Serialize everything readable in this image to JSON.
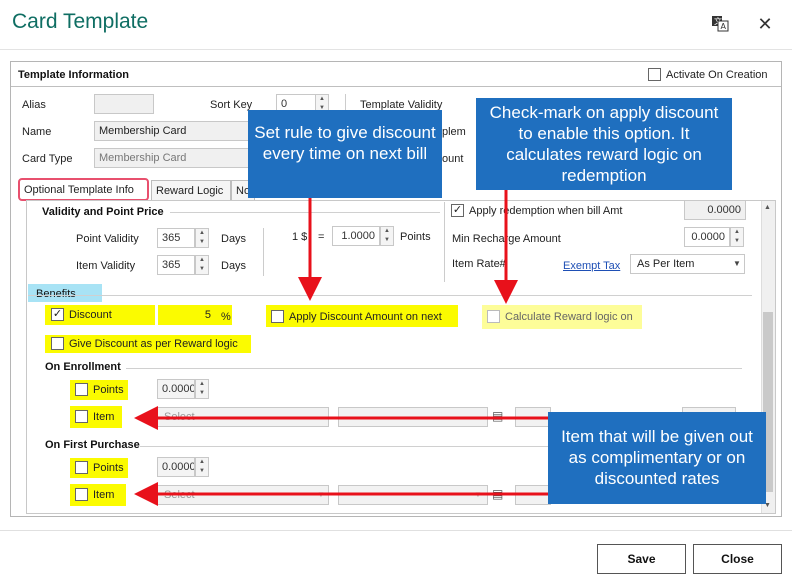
{
  "window": {
    "title": "Card Template",
    "translate_icon": "translate-icon",
    "close_icon": "close-icon"
  },
  "template_info": {
    "section_title": "Template Information",
    "activate_on_creation_label": "Activate On Creation",
    "activate_on_creation_checked": false,
    "alias_label": "Alias",
    "alias_value": "",
    "sort_key_label": "Sort Key",
    "sort_key_value": "0",
    "template_validity_label": "Template Validity",
    "name_label": "Name",
    "name_value": "Membership Card",
    "card_type_label": "Card Type",
    "card_type_value": "Membership Card",
    "partial_label_1": "plem",
    "partial_label_2": "ount"
  },
  "tabs": [
    {
      "label": "Optional Template Info",
      "active": true
    },
    {
      "label": "Reward Logic",
      "active": false
    },
    {
      "label": "No",
      "active": false
    }
  ],
  "validity": {
    "section_title": "Validity and Point Price",
    "point_validity_label": "Point Validity",
    "point_validity_value": "365",
    "item_validity_label": "Item Validity",
    "item_validity_value": "365",
    "days_label": "Days",
    "one_label": "1 $",
    "equals_label": "=",
    "points_value": "1.0000",
    "points_label": "Points"
  },
  "redemption": {
    "apply_redemption_label": "Apply redemption when bill Amt",
    "apply_redemption_checked": true,
    "apply_redemption_value": "0.0000",
    "min_recharge_label": "Min Recharge Amount",
    "min_recharge_value": "0.0000",
    "item_rate_label": "Item Rate#",
    "exempt_tax_link": "Exempt Tax",
    "item_rate_value": "As Per Item"
  },
  "benefits": {
    "header": "Benefits",
    "discount_label": "Discount",
    "discount_checked": true,
    "discount_value": "5",
    "percent_label": "%",
    "apply_discount_label": "Apply Discount Amount on next",
    "calculate_reward_label": "Calculate Reward logic on",
    "give_discount_label": "Give Discount as per Reward logic"
  },
  "on_enrollment": {
    "title": "On Enrollment",
    "points_label": "Points",
    "points_value": "0.0000",
    "item_label": "Item",
    "select_placeholder": "Select"
  },
  "on_first_purchase": {
    "title": "On First Purchase",
    "points_label": "Points",
    "points_value": "0.0000",
    "item_label": "Item",
    "select_placeholder": "Select"
  },
  "callouts": {
    "set_rule": "Set rule to give discount every time on next bill",
    "check_mark": "Check-mark on apply discount to enable this option. It calculates reward logic on redemption",
    "item_given": "Item that will be given out as complimentary or on discounted rates"
  },
  "footer": {
    "save_label": "Save",
    "close_label": "Close"
  },
  "colors": {
    "title": "#0f6e63",
    "highlight": "#fbfb00",
    "callout": "#1f6fbf",
    "arrow": "#e8111b",
    "active_tab_border": "#e8506e"
  }
}
